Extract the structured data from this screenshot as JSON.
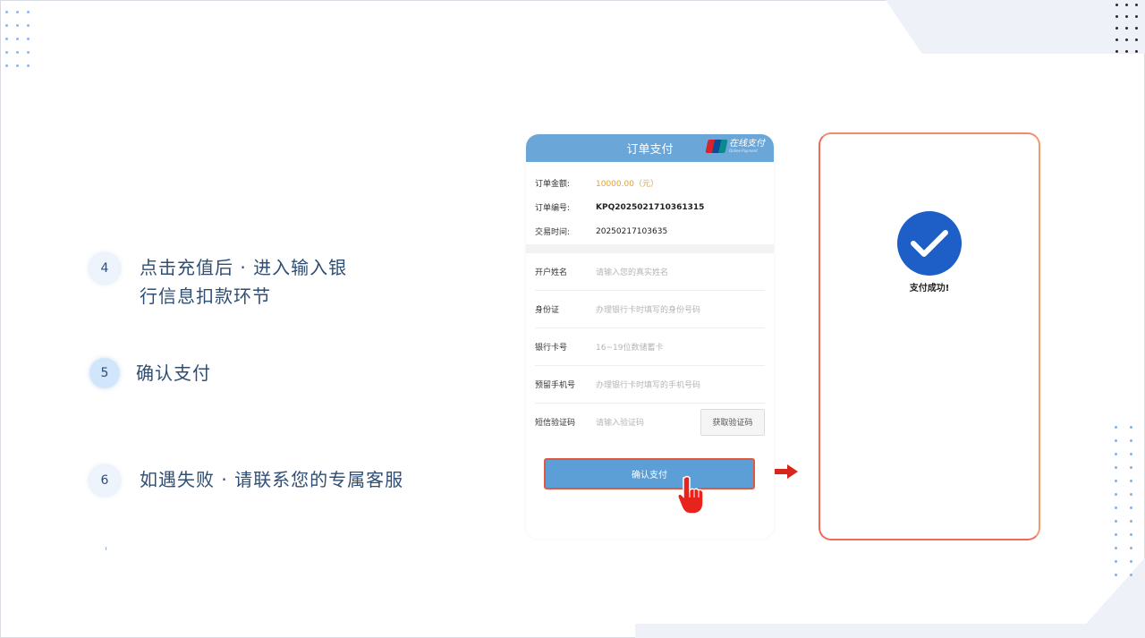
{
  "steps": [
    {
      "num": "4",
      "text_line1": "点击充值后 · 进入输入银",
      "text_line2": "行信息扣款环节"
    },
    {
      "num": "5",
      "text": "确认支付"
    },
    {
      "num": "6",
      "text": "如遇失败 · 请联系您的专属客服"
    }
  ],
  "payment_form": {
    "title": "订单支付",
    "unionpay_brand": "在线支付",
    "unionpay_sub": "Online Payment",
    "order": {
      "amount_label": "订单金额:",
      "amount_value": "10000.00（元）",
      "number_label": "订单编号:",
      "number_value": "KPQ2025021710361315",
      "time_label": "交易时间:",
      "time_value": "20250217103635"
    },
    "fields": [
      {
        "label": "开户姓名",
        "placeholder": "请输入您的真实姓名"
      },
      {
        "label": "身份证",
        "placeholder": "办理银行卡时填写的身份号码"
      },
      {
        "label": "银行卡号",
        "placeholder": "16~19位数储蓄卡"
      },
      {
        "label": "预留手机号",
        "placeholder": "办理银行卡时填写的手机号码"
      },
      {
        "label": "短信验证码",
        "placeholder": "请输入验证码"
      }
    ],
    "get_code_label": "获取验证码",
    "confirm_label": "确认支付"
  },
  "success_panel": {
    "message": "支付成功!"
  },
  "colors": {
    "header_blue": "#6aa6d8",
    "confirm_blue": "#5b9fd6",
    "amount_orange": "#e0a23a",
    "success_blue": "#1d5fc6",
    "highlight_red": "#e2583e"
  },
  "icons": {
    "pointer": "hand-pointer-icon",
    "arrow": "arrow-right-icon",
    "success": "check-circle-icon"
  }
}
